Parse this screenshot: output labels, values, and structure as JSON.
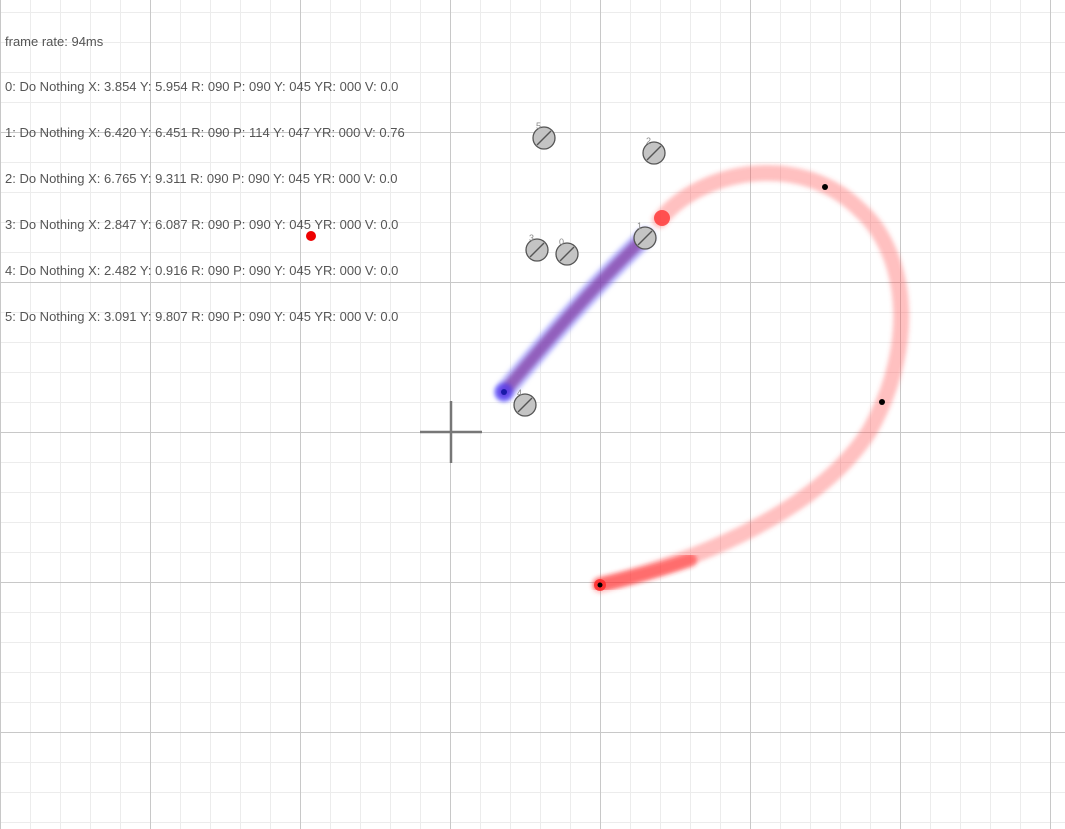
{
  "hud": {
    "frame_rate": "frame rate: 94ms",
    "rows": [
      "0: Do Nothing X: 3.854 Y: 5.954 R: 090 P: 090 Y: 045 YR: 000 V: 0.0",
      "1: Do Nothing X: 6.420 Y: 6.451 R: 090 P: 114 Y: 047 YR: 000 V: 0.76",
      "2: Do Nothing X: 6.765 Y: 9.311 R: 090 P: 090 Y: 045 YR: 000 V: 0.0",
      "3: Do Nothing X: 2.847 Y: 6.087 R: 090 P: 090 Y: 045 YR: 000 V: 0.0",
      "4: Do Nothing X: 2.482 Y: 0.916 R: 090 P: 090 Y: 045 YR: 000 V: 0.0",
      "5: Do Nothing X: 3.091 Y: 9.807 R: 090 P: 090 Y: 045 YR: 000 V: 0.0"
    ]
  },
  "drones": [
    {
      "id": "0"
    },
    {
      "id": "1"
    },
    {
      "id": "2"
    },
    {
      "id": "3"
    },
    {
      "id": "4"
    },
    {
      "id": "5"
    }
  ],
  "colors": {
    "path_red": "#ff3030",
    "path_blue": "#4040ff",
    "target": "#ee0000",
    "drone_fill": "#c4c4c4",
    "drone_stroke": "#555555",
    "crosshair": "#777777"
  }
}
